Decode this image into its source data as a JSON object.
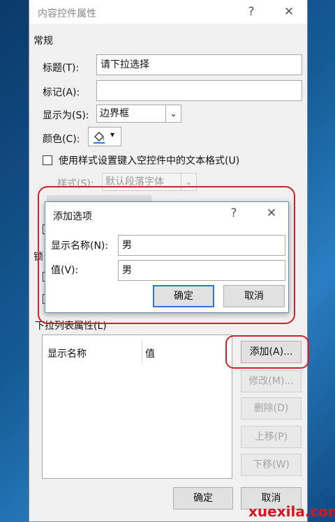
{
  "main_dialog": {
    "title": "内容控件属性",
    "help_symbol": "?",
    "close_symbol": "✕",
    "section_general": "常规",
    "title_label": "标题(T):",
    "title_value": "请下拉选择",
    "tag_label": "标记(A):",
    "tag_value": "",
    "show_as_label": "显示为(S):",
    "show_as_value": "边界框",
    "color_label": "颜色(C):",
    "color_arrow": "▾",
    "use_style_label": "使用样式设置键入空控件中的文本格式(U)",
    "style_label": "样式(S):",
    "style_value": "默认段落字体",
    "section_lock": "锁",
    "dropdown_props_label": "下拉列表属性(L)",
    "col_display": "显示名称",
    "col_value": "值",
    "btn_add": "添加(A)...",
    "btn_modify": "修改(M)...",
    "btn_delete": "删除(D)",
    "btn_up": "上移(P)",
    "btn_down": "下移(W)",
    "btn_ok": "确定",
    "btn_cancel": "取消"
  },
  "add_dialog": {
    "title": "添加选项",
    "help_symbol": "?",
    "close_symbol": "✕",
    "display_label": "显示名称(N):",
    "display_value": "男",
    "value_label": "值(V):",
    "value_value": "男",
    "btn_ok": "确定",
    "btn_cancel": "取消"
  },
  "watermark": "xuexila.com",
  "colors": {
    "highlight": "#d0202a",
    "focus": "#2e79c8"
  }
}
